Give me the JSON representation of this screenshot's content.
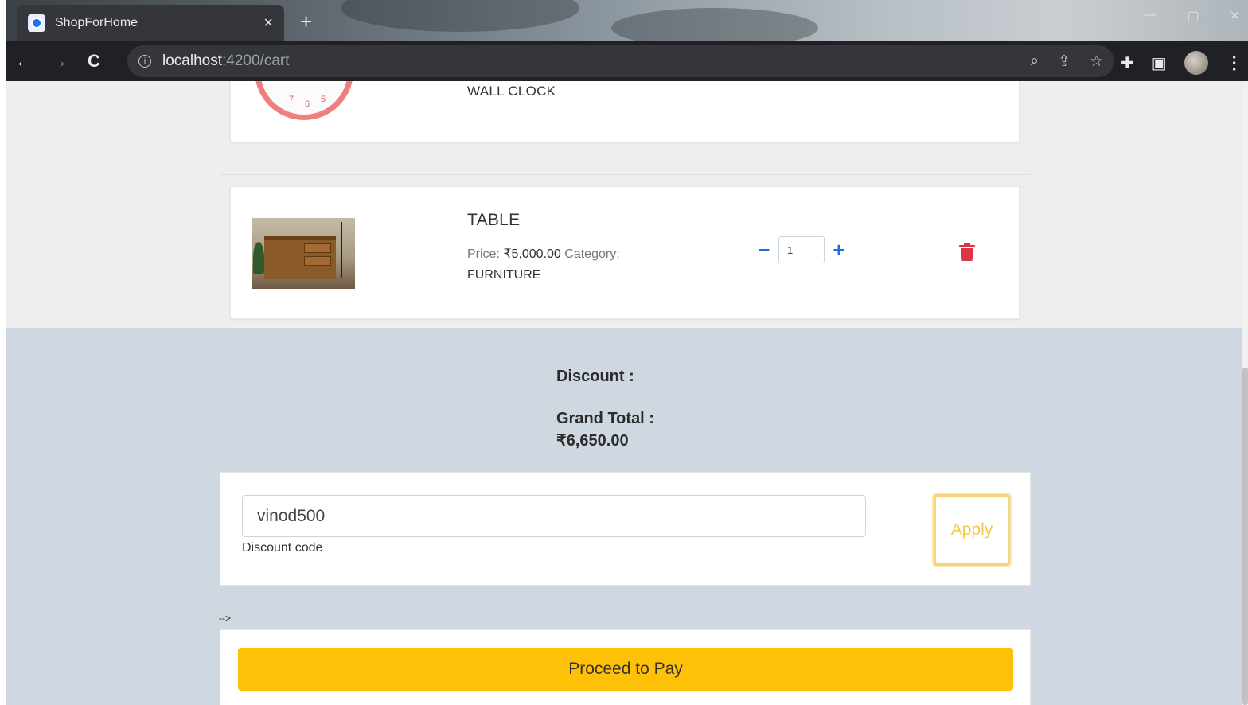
{
  "browser": {
    "tab_title": "ShopForHome",
    "tab_close": "×",
    "new_tab": "+",
    "url_host": "localhost",
    "url_path": ":4200/cart",
    "back": "←",
    "forward": "→",
    "reload": "C",
    "info_icon": "i",
    "zoom_icon": "⌕",
    "share_icon": "⇪",
    "star_icon": "☆",
    "extensions_icon": "✚",
    "sidepanel_icon": "▣",
    "menu_icon": "⋮",
    "window_min": "—",
    "window_max": "▢",
    "window_close": "✕"
  },
  "cart": {
    "items": [
      {
        "name": "WALL CLOCK",
        "icon": "wall-clock-image",
        "clock_numbers": [
          "7",
          "6",
          "5"
        ]
      },
      {
        "name": "TABLE",
        "icon": "table-image",
        "price_label": "Price:",
        "price": "₹5,000.00",
        "category_label": "Category:",
        "category": "FURNITURE",
        "quantity": "1",
        "minus": "−",
        "plus": "+"
      }
    ]
  },
  "summary": {
    "discount_label": "Discount :",
    "grand_total_label": "Grand Total :",
    "grand_total_value": "₹6,650.00"
  },
  "discount": {
    "code_value": "vinod500",
    "code_label": "Discount code",
    "apply_label": "Apply"
  },
  "stray_text": "-->",
  "pay": {
    "label": "Proceed to Pay"
  },
  "colors": {
    "accent_yellow": "#ffc107",
    "qty_blue": "#1a6fd8",
    "trash_red": "#dc3545",
    "summary_bg": "#cfd8e0"
  }
}
